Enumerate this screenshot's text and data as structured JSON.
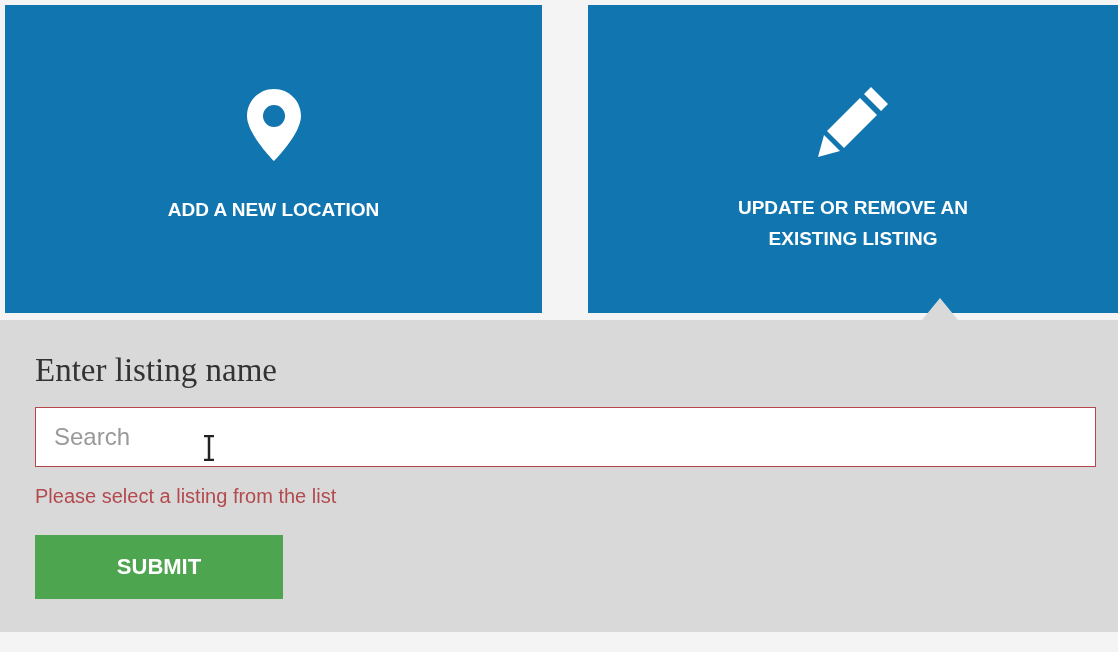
{
  "options": [
    {
      "kind": "pin",
      "label": "ADD A NEW LOCATION",
      "selected": false
    },
    {
      "kind": "pencil",
      "label": "UPDATE OR REMOVE AN EXISTING LISTING",
      "selected": true
    }
  ],
  "form": {
    "heading": "Enter listing name",
    "search": {
      "placeholder": "Search"
    },
    "error": "Please select a listing from the list",
    "submit": "SUBMIT"
  }
}
